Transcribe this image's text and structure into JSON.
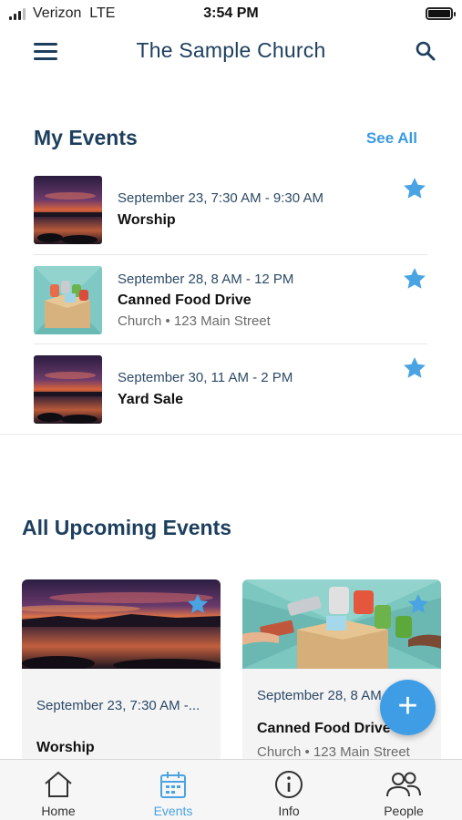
{
  "status_bar": {
    "carrier": "Verizon",
    "network": "LTE",
    "time": "3:54 PM"
  },
  "header": {
    "title": "The Sample Church"
  },
  "my_events": {
    "title": "My Events",
    "see_all": "See All",
    "items": [
      {
        "date": "September 23, 7:30 AM - 9:30 AM",
        "name": "Worship",
        "location": "",
        "starred": true
      },
      {
        "date": "September 28, 8 AM - 12 PM",
        "name": "Canned Food Drive",
        "location": "Church • 123 Main Street",
        "starred": true
      },
      {
        "date": "September 30, 11 AM - 2 PM",
        "name": "Yard Sale",
        "location": "",
        "starred": true
      }
    ]
  },
  "upcoming": {
    "title": "All Upcoming Events",
    "cards": [
      {
        "date": "September 23, 7:30 AM -...",
        "name": "Worship",
        "location": ""
      },
      {
        "date": "September 28, 8 AM -",
        "name": "Canned Food Drive",
        "location": "Church • 123 Main Street"
      }
    ]
  },
  "fab": {
    "label": "+"
  },
  "tabs": [
    {
      "label": "Home",
      "icon": "home-icon",
      "active": false
    },
    {
      "label": "Events",
      "icon": "calendar-icon",
      "active": true
    },
    {
      "label": "Info",
      "icon": "info-icon",
      "active": false
    },
    {
      "label": "People",
      "icon": "people-icon",
      "active": false
    }
  ],
  "colors": {
    "brand": "#1d3f5e",
    "accent": "#3a9ae0",
    "star": "#4aa3e3"
  }
}
